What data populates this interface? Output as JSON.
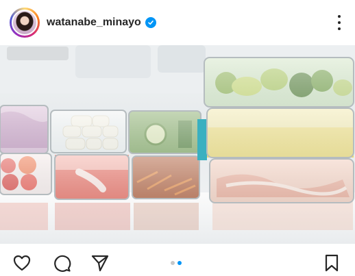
{
  "header": {
    "username": "watanabe_minayo",
    "verified": true,
    "avatar": "profile-avatar",
    "more_icon": "ellipsis-vertical-icon"
  },
  "photo": {
    "subject": "meal-prep-containers-in-refrigerator"
  },
  "actions": {
    "icons": [
      "heart-icon",
      "comment-icon",
      "share-icon",
      "bookmark-icon"
    ],
    "carousel": {
      "count": 2,
      "active_index": 1
    },
    "colors": {
      "accent": "#0095f6",
      "inactive_dot": "#c7c7c7",
      "icon": "#262626"
    }
  }
}
